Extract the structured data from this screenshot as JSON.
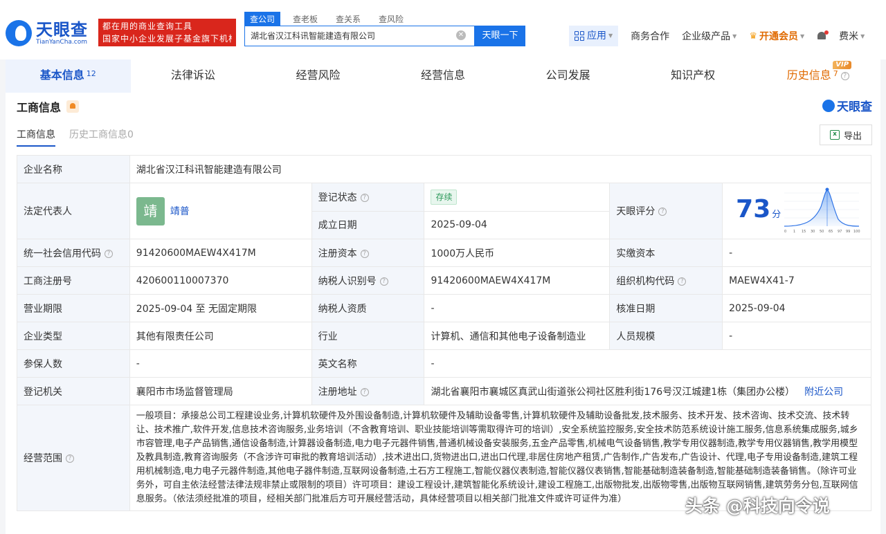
{
  "header": {
    "logo_cn": "天眼查",
    "logo_en": "TianYanCha.com",
    "slogan_line1": "都在用的商业查询工具",
    "slogan_line2": "国家中小企业发展子基金旗下机构",
    "search_tabs": [
      "查公司",
      "查老板",
      "查关系",
      "查风险"
    ],
    "search_value": "湖北省汉江科讯智能建造有限公司",
    "search_button": "天眼一下",
    "apps": "应用",
    "biz_coop": "商务合作",
    "enterprise": "企业级产品",
    "vip": "开通会员",
    "user": "费米"
  },
  "tabs": [
    {
      "label": "基本信息",
      "count": "12"
    },
    {
      "label": "法律诉讼"
    },
    {
      "label": "经营风险"
    },
    {
      "label": "经营信息"
    },
    {
      "label": "公司发展"
    },
    {
      "label": "知识产权"
    },
    {
      "label": "历史信息",
      "count": "7",
      "badge": "VIP"
    }
  ],
  "section": {
    "title": "工商信息",
    "brand": "天眼查",
    "subtabs": [
      "工商信息",
      "历史工商信息0"
    ],
    "export": "导出"
  },
  "info": {
    "company_name_label": "企业名称",
    "company_name": "湖北省汉江科讯智能建造有限公司",
    "legal_rep_label": "法定代表人",
    "legal_rep_avatar": "靖",
    "legal_rep": "靖普",
    "reg_status_label": "登记状态",
    "reg_status": "存续",
    "found_date_label": "成立日期",
    "found_date": "2025-09-04",
    "score_label": "天眼评分",
    "score": "73",
    "score_unit": "分",
    "score_ticks": [
      "0",
      "1",
      "15",
      "30",
      "50",
      "65",
      "97",
      "99",
      "100"
    ],
    "credit_code_label": "统一社会信用代码",
    "credit_code": "91420600MAEW4X417M",
    "reg_capital_label": "注册资本",
    "reg_capital": "1000万人民币",
    "paid_capital_label": "实缴资本",
    "paid_capital": "-",
    "reg_no_label": "工商注册号",
    "reg_no": "420600110007370",
    "tax_id_label": "纳税人识别号",
    "tax_id": "91420600MAEW4X417M",
    "org_code_label": "组织机构代码",
    "org_code": "MAEW4X41-7",
    "term_label": "营业期限",
    "term": "2025-09-04 至 无固定期限",
    "taxpayer_label": "纳税人资质",
    "taxpayer": "-",
    "approve_date_label": "核准日期",
    "approve_date": "2025-09-04",
    "type_label": "企业类型",
    "type": "其他有限责任公司",
    "industry_label": "行业",
    "industry": "计算机、通信和其他电子设备制造业",
    "staff_label": "人员规模",
    "staff": "-",
    "insured_label": "参保人数",
    "insured": "-",
    "en_name_label": "英文名称",
    "en_name": "-",
    "authority_label": "登记机关",
    "authority": "襄阳市市场监督管理局",
    "address_label": "注册地址",
    "address": "湖北省襄阳市襄城区真武山街道张公祠社区胜利街176号汉江城建1栋（集团办公楼）",
    "nearby": "附近公司",
    "scope_label": "经营范围",
    "scope": "一般项目：承接总公司工程建设业务,计算机软硬件及外围设备制造,计算机软硬件及辅助设备零售,计算机软硬件及辅助设备批发,技术服务、技术开发、技术咨询、技术交流、技术转让、技术推广,软件开发,信息技术咨询服务,业务培训（不含教育培训、职业技能培训等需取得许可的培训）,安全系统监控服务,安全技术防范系统设计施工服务,信息系统集成服务,城乡市容管理,电子产品销售,通信设备制造,计算器设备制造,电力电子元器件销售,普通机械设备安装服务,五金产品零售,机械电气设备销售,教学专用仪器制造,教学专用仪器销售,教学用模型及教具制造,教育咨询服务（不含涉许可审批的教育培训活动）,技术进出口,货物进出口,进出口代理,非居住房地产租赁,广告制作,广告发布,广告设计、代理,电子专用设备制造,建筑工程用机械制造,电力电子元器件制造,其他电子器件制造,互联网设备制造,土石方工程施工,智能仪器仪表制造,智能仪器仪表销售,智能基础制造装备制造,智能基础制造装备销售。（除许可业务外，可自主依法经营法律法规非禁止或限制的项目）许可项目：建设工程设计,建筑智能化系统设计,建设工程施工,出版物批发,出版物零售,出版物互联网销售,建筑劳务分包,互联网信息服务。（依法须经批准的项目，经相关部门批准后方可开展经营活动，具体经营项目以相关部门批准文件或许可证件为准）"
  },
  "watermark": "头条 @科技向令说"
}
